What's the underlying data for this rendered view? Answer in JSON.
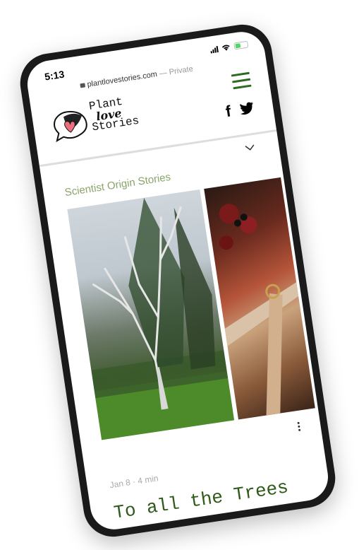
{
  "status_bar": {
    "time": "5:13"
  },
  "browser": {
    "url": "plantlovestories.com",
    "url_suffix": "— Private"
  },
  "site": {
    "logo_line1": "Plant",
    "logo_line2": "love",
    "logo_line3": "Stories"
  },
  "social": {
    "facebook": "f"
  },
  "category": "Scientist Origin Stories",
  "post": {
    "date": "Jan 8",
    "separator": "·",
    "read_time": "4 min",
    "title": "To all the Trees I've Loved Before"
  },
  "colors": {
    "accent_green": "#2e6b1e",
    "category_green": "#8aa56a"
  },
  "icons": [
    "hamburger-menu-icon",
    "facebook-icon",
    "twitter-icon",
    "chevron-down-icon",
    "more-options-icon",
    "lock-icon"
  ]
}
